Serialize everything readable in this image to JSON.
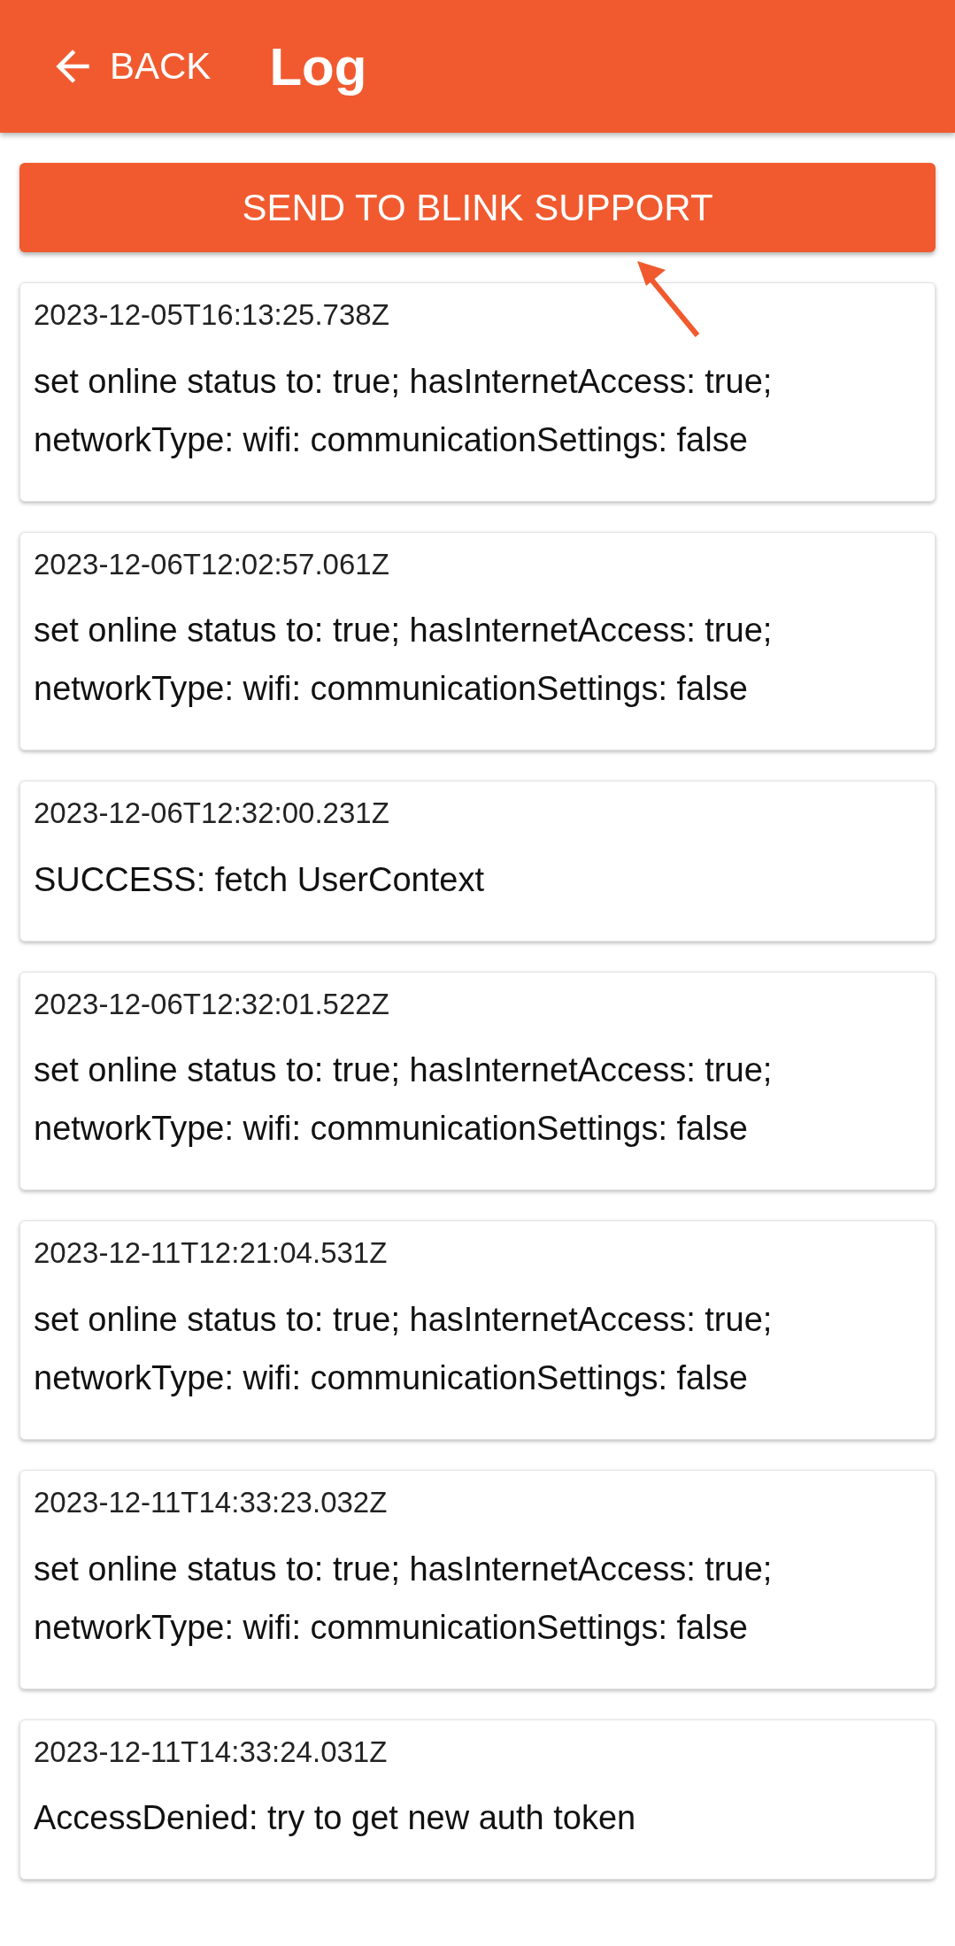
{
  "header": {
    "back_label": "BACK",
    "title": "Log"
  },
  "send_button": {
    "label": "SEND TO BLINK SUPPORT"
  },
  "entries": [
    {
      "timestamp": "2023-12-05T16:13:25.738Z",
      "message": "set online status to: true; hasInternetAccess: true; networkType: wifi: communicationSettings: false"
    },
    {
      "timestamp": "2023-12-06T12:02:57.061Z",
      "message": "set online status to: true; hasInternetAccess: true; networkType: wifi: communicationSettings: false"
    },
    {
      "timestamp": "2023-12-06T12:32:00.231Z",
      "message": "SUCCESS: fetch UserContext"
    },
    {
      "timestamp": "2023-12-06T12:32:01.522Z",
      "message": "set online status to: true; hasInternetAccess: true; networkType: wifi: communicationSettings: false"
    },
    {
      "timestamp": "2023-12-11T12:21:04.531Z",
      "message": "set online status to: true; hasInternetAccess: true; networkType: wifi: communicationSettings: false"
    },
    {
      "timestamp": "2023-12-11T14:33:23.032Z",
      "message": "set online status to: true; hasInternetAccess: true; networkType: wifi: communicationSettings: false"
    },
    {
      "timestamp": "2023-12-11T14:33:24.031Z",
      "message": "AccessDenied: try to get new auth token"
    }
  ]
}
